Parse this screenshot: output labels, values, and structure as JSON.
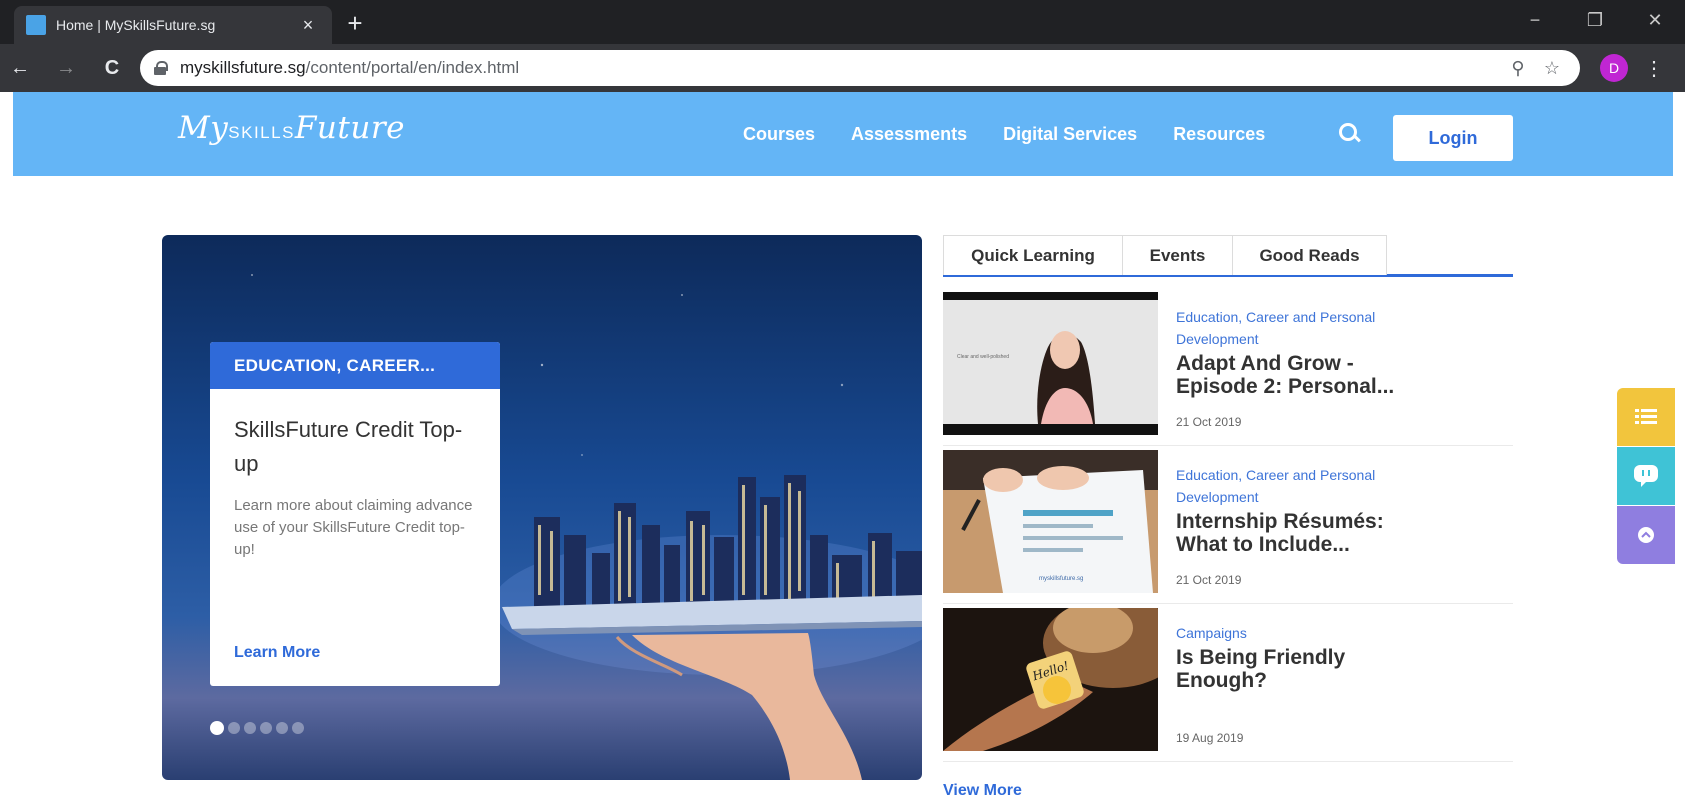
{
  "browser": {
    "tab_title": "Home | MySkillsFuture.sg",
    "tab_close": "×",
    "new_tab": "+",
    "url_domain": "myskillsfuture.sg",
    "url_path": "/content/portal/en/index.html",
    "profile_initial": "D",
    "back_icon": "←",
    "forward_icon": "→",
    "reload_icon": "C",
    "zoom_icon": "⚲",
    "star_icon": "☆",
    "menu_icon": "⋮",
    "window_controls": [
      "−",
      "❐",
      "✕"
    ]
  },
  "header": {
    "logo_prefix": "My",
    "logo_caps": "SKILLS",
    "logo_suffix": "Future",
    "nav": [
      "Courses",
      "Assessments",
      "Digital Services",
      "Resources"
    ],
    "login_label": "Login",
    "color": "#64b5f6"
  },
  "hero": {
    "tag": "EDUCATION, CAREER...",
    "title": "SkillsFuture Credit Top-up",
    "description": "Learn more about claiming advance use of your SkillsFuture Credit top-up!",
    "link": "Learn More",
    "slide_count": 6,
    "active_slide": 1
  },
  "panel": {
    "tabs": [
      "Quick Learning",
      "Events",
      "Good Reads"
    ],
    "active_tab": "Quick Learning",
    "articles": [
      {
        "category": "Education, Career and Personal Development",
        "title": "Adapt And Grow - Episode 2: Personal...",
        "date": "21 Oct 2019",
        "thumb_text": "Clear and well-polished"
      },
      {
        "category": "Education, Career and Personal Development",
        "title": "Internship Résumés: What to Include...",
        "date": "21 Oct 2019",
        "thumb_text": "myskillsfuture.sg"
      },
      {
        "category": "Campaigns",
        "title": "Is Being Friendly Enough?",
        "date": "19 Aug 2019",
        "thumb_text": "Hello!"
      }
    ],
    "view_more": "View More"
  },
  "side_buttons": {
    "icons": [
      "list-icon",
      "chat-icon",
      "scroll-up-icon"
    ],
    "colors": [
      "#f2c53d",
      "#3fc3d6",
      "#8f7ee0"
    ]
  },
  "accent_color": "#2f6ad9"
}
